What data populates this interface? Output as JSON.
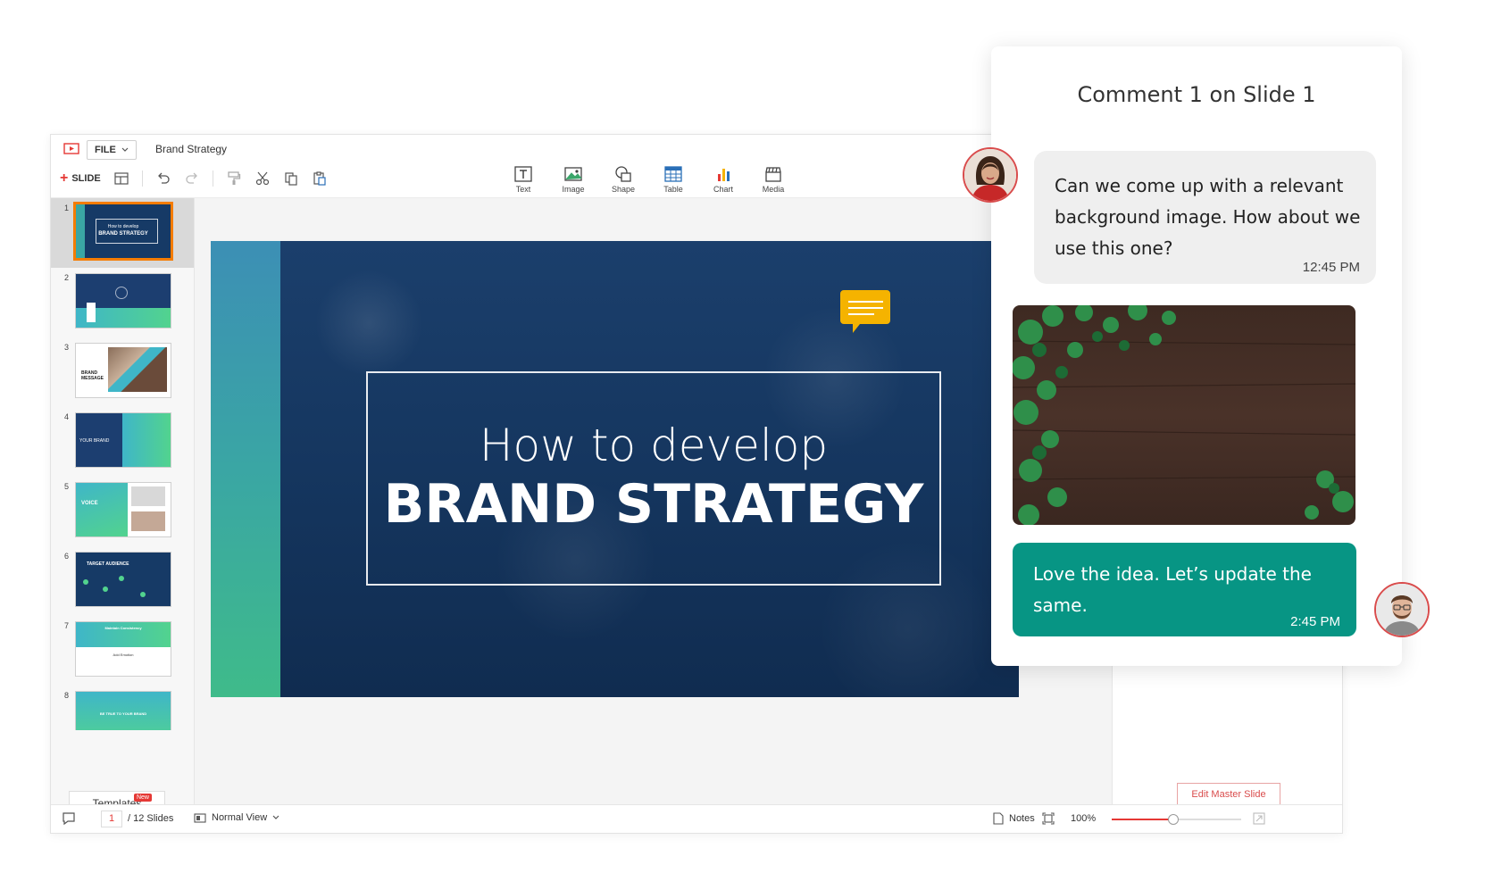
{
  "app": {
    "file_label": "FILE",
    "doc_title": "Brand Strategy",
    "slide_label": "SLIDE"
  },
  "insert_tools": [
    {
      "label": "Text",
      "icon": "text-icon"
    },
    {
      "label": "Image",
      "icon": "image-icon"
    },
    {
      "label": "Shape",
      "icon": "shape-icon"
    },
    {
      "label": "Table",
      "icon": "table-icon"
    },
    {
      "label": "Chart",
      "icon": "chart-icon"
    },
    {
      "label": "Media",
      "icon": "media-icon"
    }
  ],
  "thumbnails": [
    {
      "num": "1",
      "line1": "How to develop",
      "line2": "BRAND STRATEGY"
    },
    {
      "num": "2"
    },
    {
      "num": "3",
      "line1": "BRAND",
      "line2": "MESSAGE"
    },
    {
      "num": "4",
      "line1": "YOUR BRAND"
    },
    {
      "num": "5",
      "line1": "VOICE"
    },
    {
      "num": "6",
      "line1": "TARGET AUDIENCE"
    },
    {
      "num": "7",
      "line1": "Maintain Consistency",
      "line2": "Add Emotion"
    },
    {
      "num": "8",
      "line1": "BE TRUE TO YOUR BRAND"
    }
  ],
  "templates": {
    "label": "Templates",
    "badge": "New"
  },
  "slide": {
    "line1": "How to develop",
    "line2": "BRAND STRATEGY"
  },
  "edit_master_label": "Edit Master Slide",
  "status": {
    "page": "1",
    "total": "/ 12 Slides",
    "view": "Normal View",
    "notes": "Notes",
    "zoom": "100%",
    "zoom_fraction": 0.47
  },
  "comments": {
    "title": "Comment 1 on Slide 1",
    "first": {
      "text": "Can we come up with a relevant background image. How about we use this one?",
      "time": "12:45 PM"
    },
    "reply": {
      "text": "Love the idea. Let’s update the same.",
      "time": "2:45 PM"
    }
  },
  "colors": {
    "accent": "#e53935",
    "reply_bubble": "#079584",
    "slide_bg": "#13345e",
    "comment_marker": "#f5b300"
  }
}
